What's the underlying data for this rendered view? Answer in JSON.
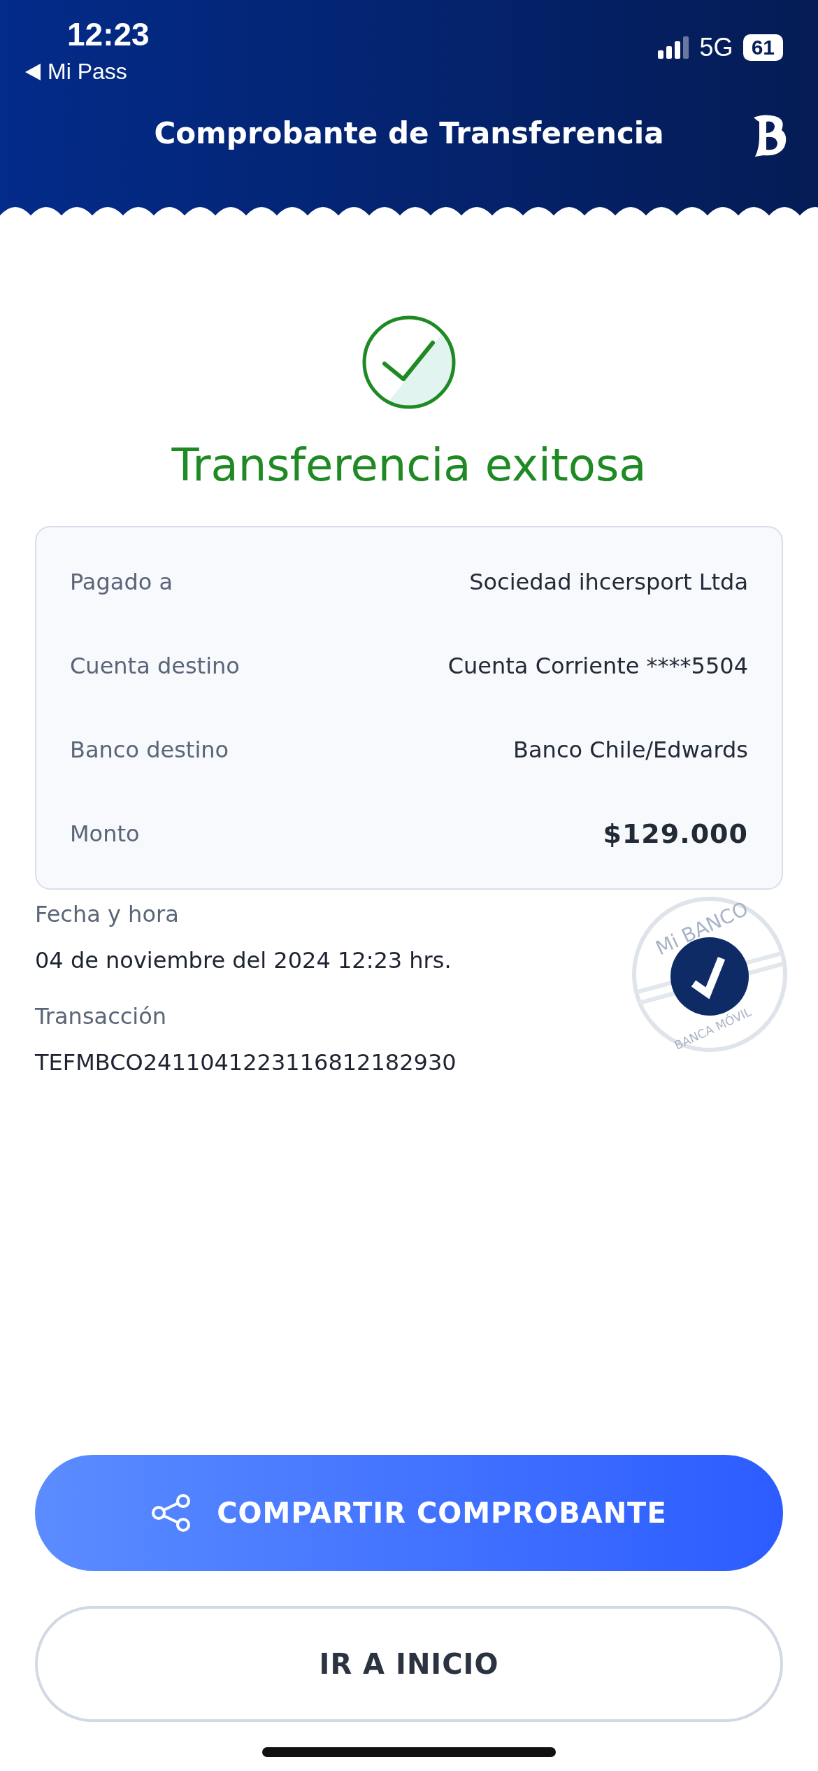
{
  "status_bar": {
    "time": "12:23",
    "back_app": "Mi Pass",
    "network": "5G",
    "battery": "61"
  },
  "header": {
    "title": "Comprobante de Transferencia"
  },
  "result": {
    "title": "Transferencia exitosa"
  },
  "details": [
    {
      "label": "Pagado a",
      "value": "Sociedad ihcersport Ltda",
      "kind": "plain"
    },
    {
      "label": "Cuenta destino",
      "value": "Cuenta Corriente ****5504",
      "kind": "plain"
    },
    {
      "label": "Banco destino",
      "value": "Banco Chile/Edwards",
      "kind": "plain"
    },
    {
      "label": "Monto",
      "value": "$129.000",
      "kind": "amount"
    }
  ],
  "info": [
    {
      "label": "Fecha y hora",
      "value": "04 de noviembre del 2024 12:23 hrs."
    },
    {
      "label": "Transacción",
      "value": "TEFMBCO2411041223116812182930"
    }
  ],
  "stamp": {
    "top_text": "Mi BANCO",
    "bottom_text": "BANCA MÓVIL"
  },
  "buttons": [
    {
      "label": "COMPARTIR COMPROBANTE",
      "kind": "primary"
    },
    {
      "label": "IR A INICIO",
      "kind": "secondary"
    }
  ]
}
